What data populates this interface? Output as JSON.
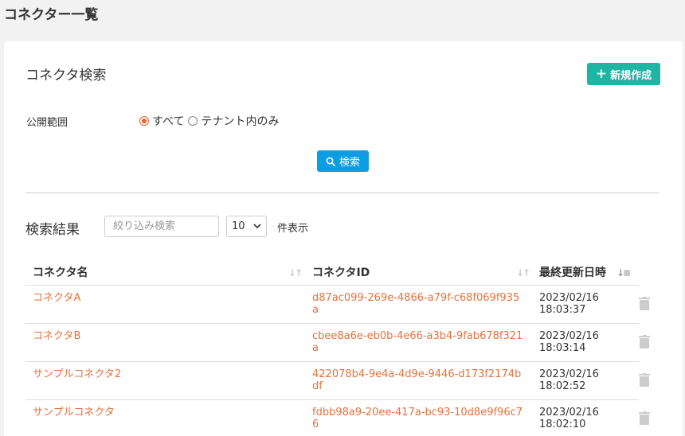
{
  "page": {
    "title": "コネクター一覧"
  },
  "search": {
    "section_title": "コネクタ検索",
    "new_button_label": "新規作成",
    "scope_label": "公開範囲",
    "scope_options": [
      {
        "label": "すべて",
        "checked": true
      },
      {
        "label": "テナント内のみ",
        "checked": false
      }
    ],
    "search_button_label": "検索"
  },
  "results": {
    "title": "検索結果",
    "filter_placeholder": "絞り込み検索",
    "per_page_value": "10",
    "per_page_suffix": "件表示",
    "columns": [
      "コネクタ名",
      "コネクタID",
      "最終更新日時"
    ],
    "rows": [
      {
        "name": "コネクタA",
        "id": "d87ac099-269e-4866-a79f-c68f069f935a",
        "date": "2023/02/16",
        "time": "18:03:37"
      },
      {
        "name": "コネクタB",
        "id": "cbee8a6e-eb0b-4e66-a3b4-9fab678f321a",
        "date": "2023/02/16",
        "time": "18:03:14"
      },
      {
        "name": "サンプルコネクタ2",
        "id": "422078b4-9e4a-4d9e-9446-d173f2174bdf",
        "date": "2023/02/16",
        "time": "18:02:52"
      },
      {
        "name": "サンプルコネクタ",
        "id": "fdbb98a9-20ee-417a-bc93-10d8e9f96c76",
        "date": "2023/02/16",
        "time": "18:02:10"
      }
    ]
  },
  "colors": {
    "accent": "#1fb5a3",
    "link": "#e8703a",
    "primary": "#0d9de3",
    "radio": "#e8602c"
  },
  "icons": {
    "new": "plus-icon",
    "search": "search-icon",
    "delete": "trash-icon",
    "sort": "sort-icon"
  }
}
